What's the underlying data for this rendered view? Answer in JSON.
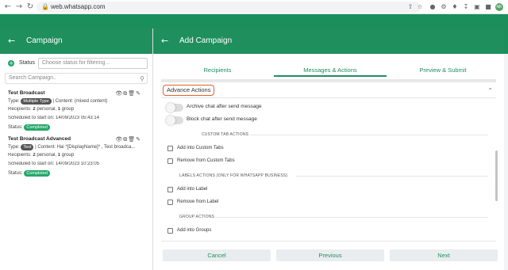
{
  "browser": {
    "url": "web.whatsapp.com",
    "back_icon": "arrow-left",
    "forward_icon": "arrow-right",
    "reload_icon": "reload",
    "profile_initials": "NK"
  },
  "left": {
    "header_title": "Campaign",
    "status_label": "Status",
    "status_placeholder": "Choose status for filtering...",
    "search_placeholder": "Search Campaign..",
    "campaigns": [
      {
        "title": "Test Broadcast",
        "type_prefix": "Type:",
        "type_tag": "Multiple Type",
        "content": "| Content: (mixed content)",
        "recipients_prefix": "Recipients:",
        "recipients_personal": "2",
        "recipients_mid": "personal,",
        "recipients_group": "1",
        "recipients_suffix": "group",
        "scheduled": "Scheduled to start on: 14/09/2023 05:43:14",
        "status_prefix": "Status:",
        "status_badge": "Completed"
      },
      {
        "title": "Test Broadcast Advanced",
        "type_prefix": "Type:",
        "type_tag": "Text",
        "content": "| Content: Hai *[DisplayName]* , Test broadca...",
        "recipients_prefix": "Recipients:",
        "recipients_personal": "2",
        "recipients_mid": "personal,",
        "recipients_group": "1",
        "recipients_suffix": "group",
        "scheduled": "Scheduled to start on: 14/09/2023 10:23:05",
        "status_prefix": "Status:",
        "status_badge": "Completed"
      }
    ]
  },
  "right": {
    "header_title": "Add Campaign",
    "tabs": [
      {
        "label": "Recipients"
      },
      {
        "label": "Messages & Actions"
      },
      {
        "label": "Preview & Submit"
      }
    ],
    "advance_actions_label": "Advance Actions",
    "toggles": [
      {
        "label": "Archive chat after send message"
      },
      {
        "label": "Block chat after send message"
      }
    ],
    "custom_tab_heading": "CUSTOM TAB ACTIONS",
    "custom_tab_options": [
      {
        "label": "Add into Custom Tabs"
      },
      {
        "label": "Remove from Custom Tabs"
      }
    ],
    "labels_heading": "LABELS ACTIONS (ONLY FOR WHATSAPP BUSINESS)",
    "labels_options": [
      {
        "label": "Add into Label"
      },
      {
        "label": "Remove from Label"
      }
    ],
    "group_heading": "GROUP ACTIONS",
    "group_options": [
      {
        "label": "Add into Groups"
      }
    ]
  },
  "footer": {
    "cancel": "Cancel",
    "previous": "Previous",
    "next": "Next"
  },
  "colors": {
    "brand_green": "#1f8f5e",
    "highlight_orange": "#e0632b",
    "badge_green": "#25a86a"
  }
}
